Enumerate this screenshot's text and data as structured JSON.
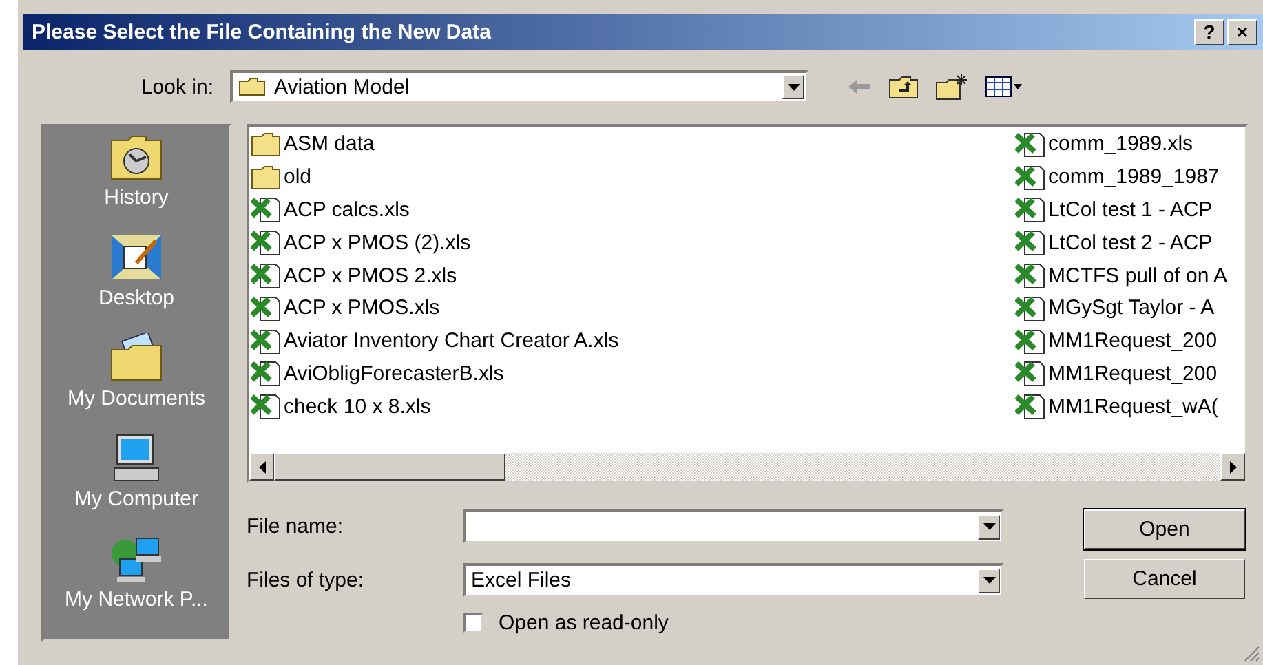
{
  "window": {
    "title": "Please Select the File Containing the New Data",
    "title_buttons": [
      "?",
      "×"
    ]
  },
  "look_in": {
    "label": "Look in:",
    "value": "Aviation Model"
  },
  "places": [
    {
      "kind": "history",
      "label": "History"
    },
    {
      "kind": "desktop",
      "label": "Desktop"
    },
    {
      "kind": "documents",
      "label": "My Documents"
    },
    {
      "kind": "computer",
      "label": "My Computer"
    },
    {
      "kind": "network",
      "label": "My Network P..."
    }
  ],
  "file_columns": [
    [
      {
        "kind": "folder",
        "name": "ASM data"
      },
      {
        "kind": "folder",
        "name": "old"
      },
      {
        "kind": "excel",
        "name": "ACP calcs.xls"
      },
      {
        "kind": "excel",
        "name": "ACP x PMOS (2).xls"
      },
      {
        "kind": "excel",
        "name": "ACP x PMOS 2.xls"
      },
      {
        "kind": "excel",
        "name": "ACP x PMOS.xls"
      },
      {
        "kind": "excel",
        "name": "Aviator Inventory Chart Creator A.xls"
      },
      {
        "kind": "excel",
        "name": "AviObligForecasterB.xls"
      },
      {
        "kind": "excel",
        "name": "check 10 x 8.xls"
      }
    ],
    [
      {
        "kind": "excel",
        "name": "comm_1989.xls"
      },
      {
        "kind": "excel",
        "name": "comm_1989_1987"
      },
      {
        "kind": "excel",
        "name": "LtCol test 1 - ACP"
      },
      {
        "kind": "excel",
        "name": "LtCol test 2 - ACP"
      },
      {
        "kind": "excel",
        "name": "MCTFS pull of on A"
      },
      {
        "kind": "excel",
        "name": "MGySgt Taylor - A"
      },
      {
        "kind": "excel",
        "name": "MM1Request_200"
      },
      {
        "kind": "excel",
        "name": "MM1Request_200"
      },
      {
        "kind": "excel",
        "name": "MM1Request_wA("
      }
    ]
  ],
  "file_name": {
    "label": "File name:"
  },
  "file_type": {
    "label": "Files of type:",
    "value": "Excel Files"
  },
  "read_only": {
    "label": "Open as read-only",
    "checked": false
  },
  "buttons": [
    "Open",
    "Cancel"
  ]
}
